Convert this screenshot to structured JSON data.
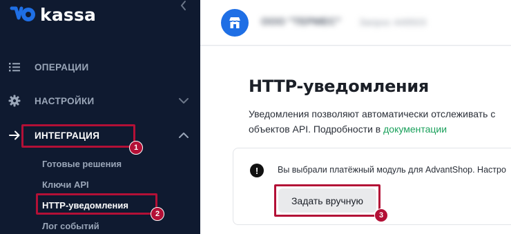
{
  "brand": {
    "logo_text": "kassa"
  },
  "sidebar": {
    "nav": [
      {
        "label": "ОПЕРАЦИИ",
        "icon": "list-icon"
      },
      {
        "label": "НАСТРОЙКИ",
        "icon": "gear-icon"
      },
      {
        "label": "ИНТЕГРАЦИЯ",
        "icon": "arrow-right-icon"
      }
    ],
    "subnav": [
      {
        "label": "Готовые решения"
      },
      {
        "label": "Ключи API"
      },
      {
        "label": "HTTP-уведомления"
      },
      {
        "label": "Лог событий"
      }
    ]
  },
  "markers": [
    "1",
    "2",
    "3"
  ],
  "header": {
    "shop_name": "ООО \"ТЕРМЕС\"",
    "shop_id": "Запрос 449503"
  },
  "main": {
    "title": "HTTP-уведомления",
    "description_line1": "Уведомления позволяют автоматически отслеживать с",
    "description_line2_prefix": "объектов API. Подробности в ",
    "description_link": "документации",
    "notice_text": "Вы выбрали платёжный модуль для AdvantShop. Настро",
    "manual_button": "Задать вручную"
  },
  "colors": {
    "sidebar_bg": "#0f1a30",
    "accent_blue": "#1f6fe5",
    "link_green": "#1aa05b",
    "highlight_red": "#b31036"
  }
}
